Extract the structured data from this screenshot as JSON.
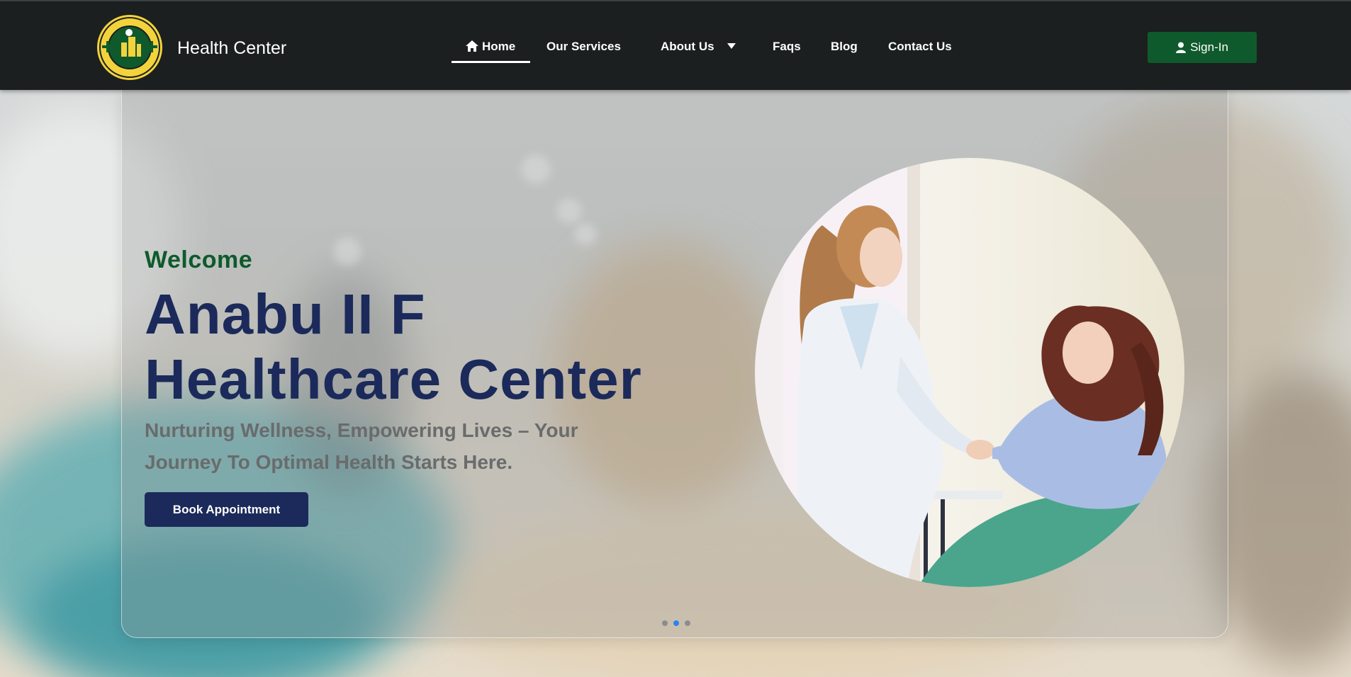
{
  "header": {
    "brand": "Health Center",
    "logo_icon": "health-center-seal-icon",
    "nav": {
      "home": "Home",
      "services": "Our Services",
      "about": "About Us",
      "faqs": "Faqs",
      "blog": "Blog",
      "contact": "Contact Us"
    },
    "signin": "Sign-In"
  },
  "hero": {
    "welcome": "Welcome",
    "title_line1": "Anabu II F",
    "title_line2": "Healthcare Center",
    "subtitle_line1": "Nurturing Wellness, Empowering Lives – Your",
    "subtitle_line2": "Journey To Optimal Health Starts Here.",
    "cta": "Book Appointment",
    "image": "doctor-greeting-patient-illustration",
    "slides_total": 3,
    "slide_active": 2
  },
  "colors": {
    "header_bg": "#1b1f20",
    "brand_green": "#0f5a2c",
    "navy": "#1b2a5a",
    "dot_active": "#2a84f0"
  }
}
